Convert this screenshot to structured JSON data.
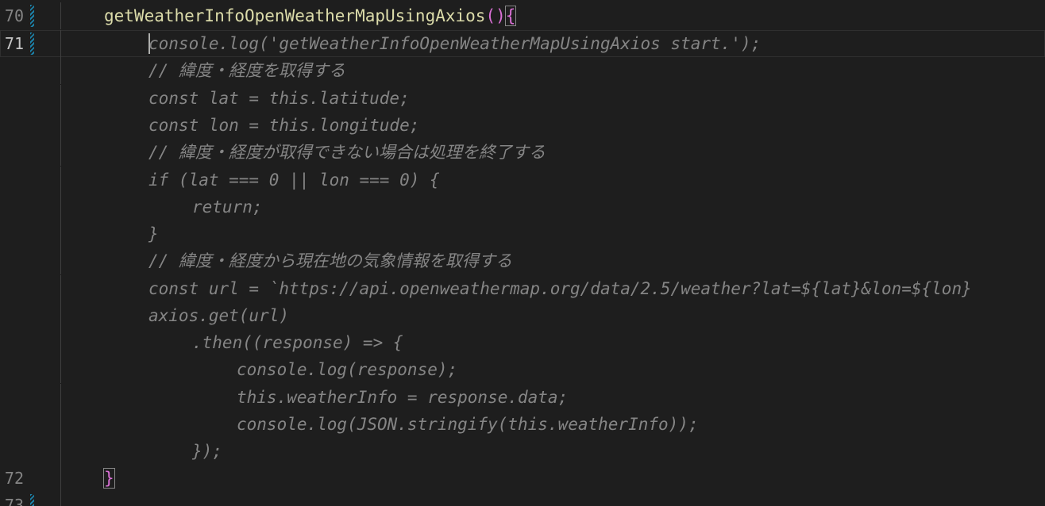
{
  "editor": {
    "line_numbers": {
      "l70": "70",
      "l71": "71",
      "l72": "72",
      "l73": "73"
    },
    "lines": {
      "fn_name": "getWeatherInfoOpenWeatherMapUsingAxios",
      "fn_open_paren": "(",
      "fn_close_paren": ")",
      "fn_open_brace": "{",
      "log_start": "console.log('getWeatherInfoOpenWeatherMapUsingAxios start.');",
      "comment_latlon": "// 緯度・経度を取得する",
      "const_lat": "const lat = this.latitude;",
      "const_lon": "const lon = this.longitude;",
      "comment_abort": "// 緯度・経度が取得できない場合は処理を終了する",
      "if_check": "if (lat === 0 || lon === 0) {",
      "return_stmt": "return;",
      "close_if": "}",
      "comment_fetch": "// 緯度・経度から現在地の気象情報を取得する",
      "const_url": "const url = `https://api.openweathermap.org/data/2.5/weather?lat=${lat}&lon=${lon}",
      "axios_get": "axios.get(url)",
      "then_open": ".then((response) => {",
      "log_response": "console.log(response);",
      "assign_info": "this.weatherInfo = response.data;",
      "log_json": "console.log(JSON.stringify(this.weatherInfo));",
      "then_close": "});",
      "fn_close_brace": "}"
    }
  },
  "colors": {
    "background": "#1e1e1e",
    "function_name": "#dcdcaa",
    "bracket": "#da70d6",
    "faded_code": "#858585",
    "line_number": "#858585",
    "line_number_active": "#c6c6c6",
    "gutter_modified": "#1b81a8"
  }
}
